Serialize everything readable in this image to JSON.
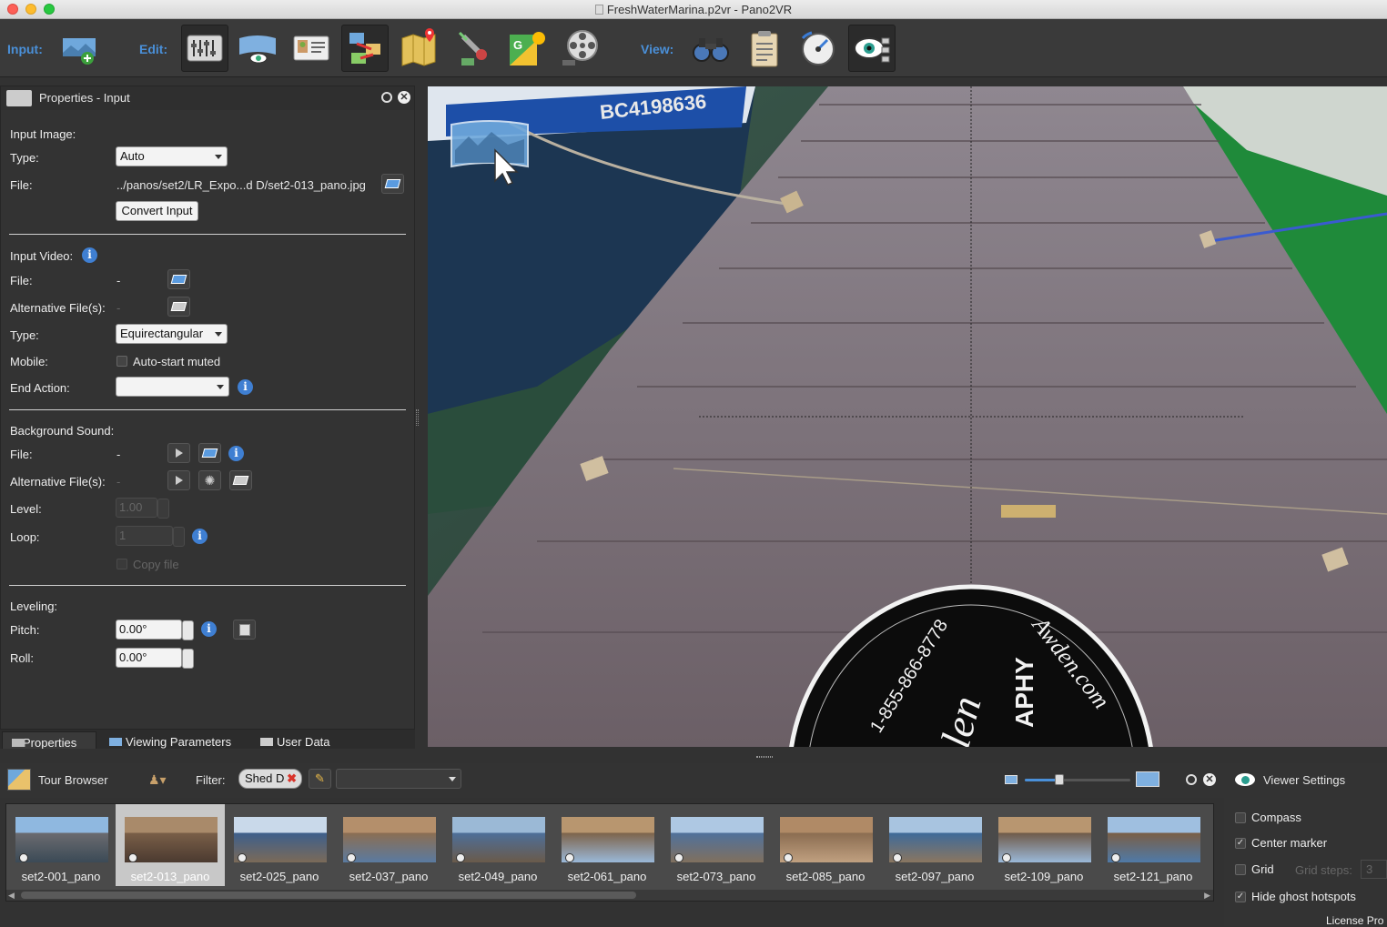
{
  "window": {
    "title": "FreshWaterMarina.p2vr - Pano2VR"
  },
  "toolbar": {
    "input_label": "Input:",
    "edit_label": "Edit:",
    "view_label": "View:",
    "accent_color": "#4a90d9"
  },
  "properties": {
    "title": "Properties - Input",
    "input_image": {
      "heading": "Input Image:",
      "type_label": "Type:",
      "type_value": "Auto",
      "file_label": "File:",
      "file_value": "../panos/set2/LR_Expo...d D/set2-013_pano.jpg",
      "convert_button": "Convert Input"
    },
    "input_video": {
      "heading": "Input Video:",
      "file_label": "File:",
      "file_value": "-",
      "alt_label": "Alternative File(s):",
      "alt_value": "-",
      "type_label": "Type:",
      "type_value": "Equirectangular",
      "mobile_label": "Mobile:",
      "autostart_label": "Auto-start muted",
      "end_action_label": "End Action:",
      "end_action_value": ""
    },
    "background_sound": {
      "heading": "Background Sound:",
      "file_label": "File:",
      "file_value": "-",
      "alt_label": "Alternative File(s):",
      "alt_value": "-",
      "level_label": "Level:",
      "level_value": "1.00",
      "loop_label": "Loop:",
      "loop_value": "1",
      "copy_file_label": "Copy file"
    },
    "leveling": {
      "heading": "Leveling:",
      "pitch_label": "Pitch:",
      "pitch_value": "0.00°",
      "roll_label": "Roll:",
      "roll_value": "0.00°"
    }
  },
  "tabs": [
    {
      "label": "Properties"
    },
    {
      "label": "Viewing Parameters"
    },
    {
      "label": "User Data"
    }
  ],
  "viewer": {
    "boat_text": "BC4198636",
    "watermark_phone": "1-855-866-8778",
    "watermark_brand": "Awden.com",
    "watermark_bottom_left": "len",
    "watermark_bottom_right": "APHY"
  },
  "tour_browser": {
    "title": "Tour Browser",
    "filter_label": "Filter:",
    "filter_tag": "Shed D",
    "filter_combo_value": "",
    "zoom_fraction": 0.33,
    "selected_index": 1,
    "thumbnails": [
      {
        "label": "set2-001_pano"
      },
      {
        "label": "set2-013_pano"
      },
      {
        "label": "set2-025_pano"
      },
      {
        "label": "set2-037_pano"
      },
      {
        "label": "set2-049_pano"
      },
      {
        "label": "set2-061_pano"
      },
      {
        "label": "set2-073_pano"
      },
      {
        "label": "set2-085_pano"
      },
      {
        "label": "set2-097_pano"
      },
      {
        "label": "set2-109_pano"
      },
      {
        "label": "set2-121_pano"
      }
    ]
  },
  "viewer_settings": {
    "title": "Viewer Settings",
    "compass_label": "Compass",
    "center_marker_label": "Center marker",
    "grid_label": "Grid",
    "grid_steps_label": "Grid steps:",
    "grid_steps_value": "3",
    "hide_ghost_label": "Hide ghost hotspots",
    "license_text": "License Pro"
  }
}
